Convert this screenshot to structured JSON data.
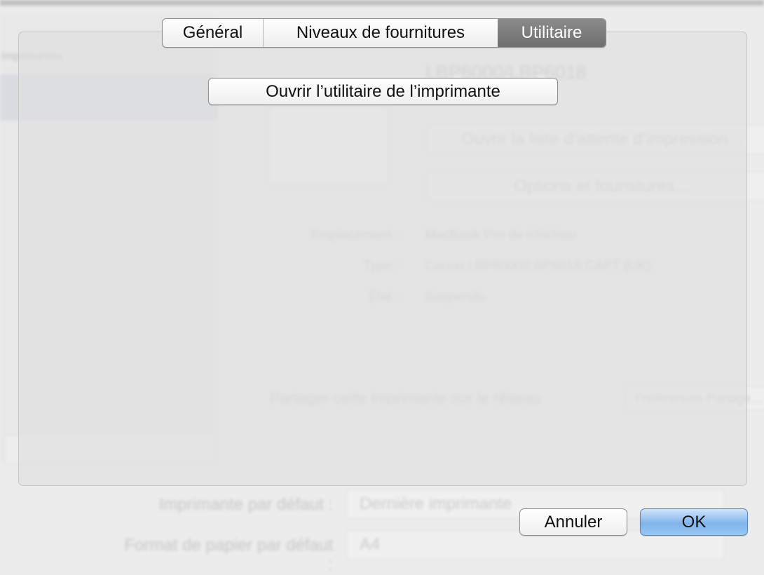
{
  "background": {
    "sidebar_header": "Imprimantes",
    "printer_title": "LBP6000/LBP6018",
    "buttons": {
      "open_queue": "Ouvrir la liste d’attente d’impression…",
      "options": "Options et fournitures…"
    },
    "info": [
      {
        "label": "Emplacement :",
        "value": "MacBook Pro de ichichou"
      },
      {
        "label": "Type :",
        "value": "Canon LBP6000/LBP6018 CAPT (UK)"
      },
      {
        "label": "État :",
        "value": "Suspendu"
      }
    ],
    "share_label": "Partager cette imprimante sur le réseau",
    "share_button": "Préférences Partage…",
    "default_printer_label": "Imprimante par défaut :",
    "default_printer_value": "Dernière imprimante",
    "paper_label": "Format de papier par défaut :",
    "paper_value": "A4"
  },
  "sheet": {
    "tabs": [
      {
        "label": "Général"
      },
      {
        "label": "Niveaux de fournitures"
      },
      {
        "label": "Utilitaire",
        "active": true
      }
    ],
    "open_utility_button": "Ouvrir l’utilitaire de l’imprimante",
    "cancel_button": "Annuler",
    "ok_button": "OK"
  },
  "colors": {
    "accent_ok": "#7fb5ec",
    "active_tab": "#7a7a7a"
  }
}
